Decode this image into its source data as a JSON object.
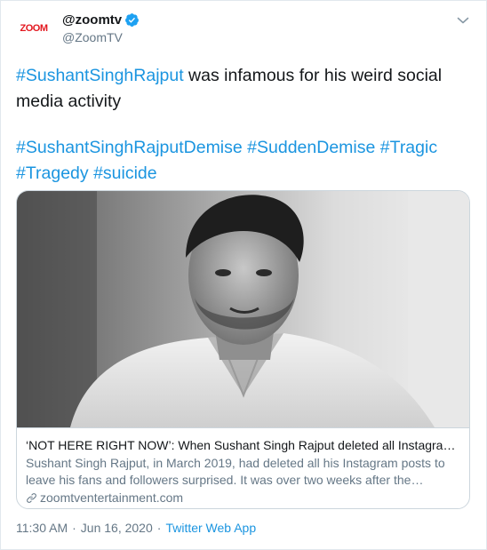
{
  "account": {
    "logo_text": "ZOOM",
    "display_name": "@zoomtv",
    "handle": "@ZoomTV",
    "verified": true
  },
  "tweet": {
    "line1": {
      "hashtag": "#SushantSinghRajput",
      "text": " was infamous for his weird social media activity"
    },
    "hashtags": [
      "#SushantSinghRajputDemise",
      "#SuddenDemise",
      "#Tragic",
      "#Tragedy",
      "#suicide"
    ]
  },
  "card": {
    "title": "‘NOT HERE RIGHT NOW’: When Sushant Singh Rajput deleted all Instagram ...",
    "description": "Sushant Singh Rajput, in March 2019, had deleted all his Instagram posts to leave his fans and followers surprised. It was over two weeks after the failure...",
    "domain": "zoomtventertainment.com",
    "image_icon": "portrait-photo"
  },
  "footer": {
    "time": "11:30 AM",
    "separator": "·",
    "date": "Jun 16, 2020",
    "source": "Twitter Web App"
  },
  "icons": {
    "verified": "verified-badge-icon",
    "menu": "chevron-down-icon",
    "link": "link-icon"
  },
  "colors": {
    "hashtag": "#1b95e0",
    "brand_logo": "#e3171f",
    "secondary_text": "#657786",
    "verified": "#1da1f2"
  }
}
